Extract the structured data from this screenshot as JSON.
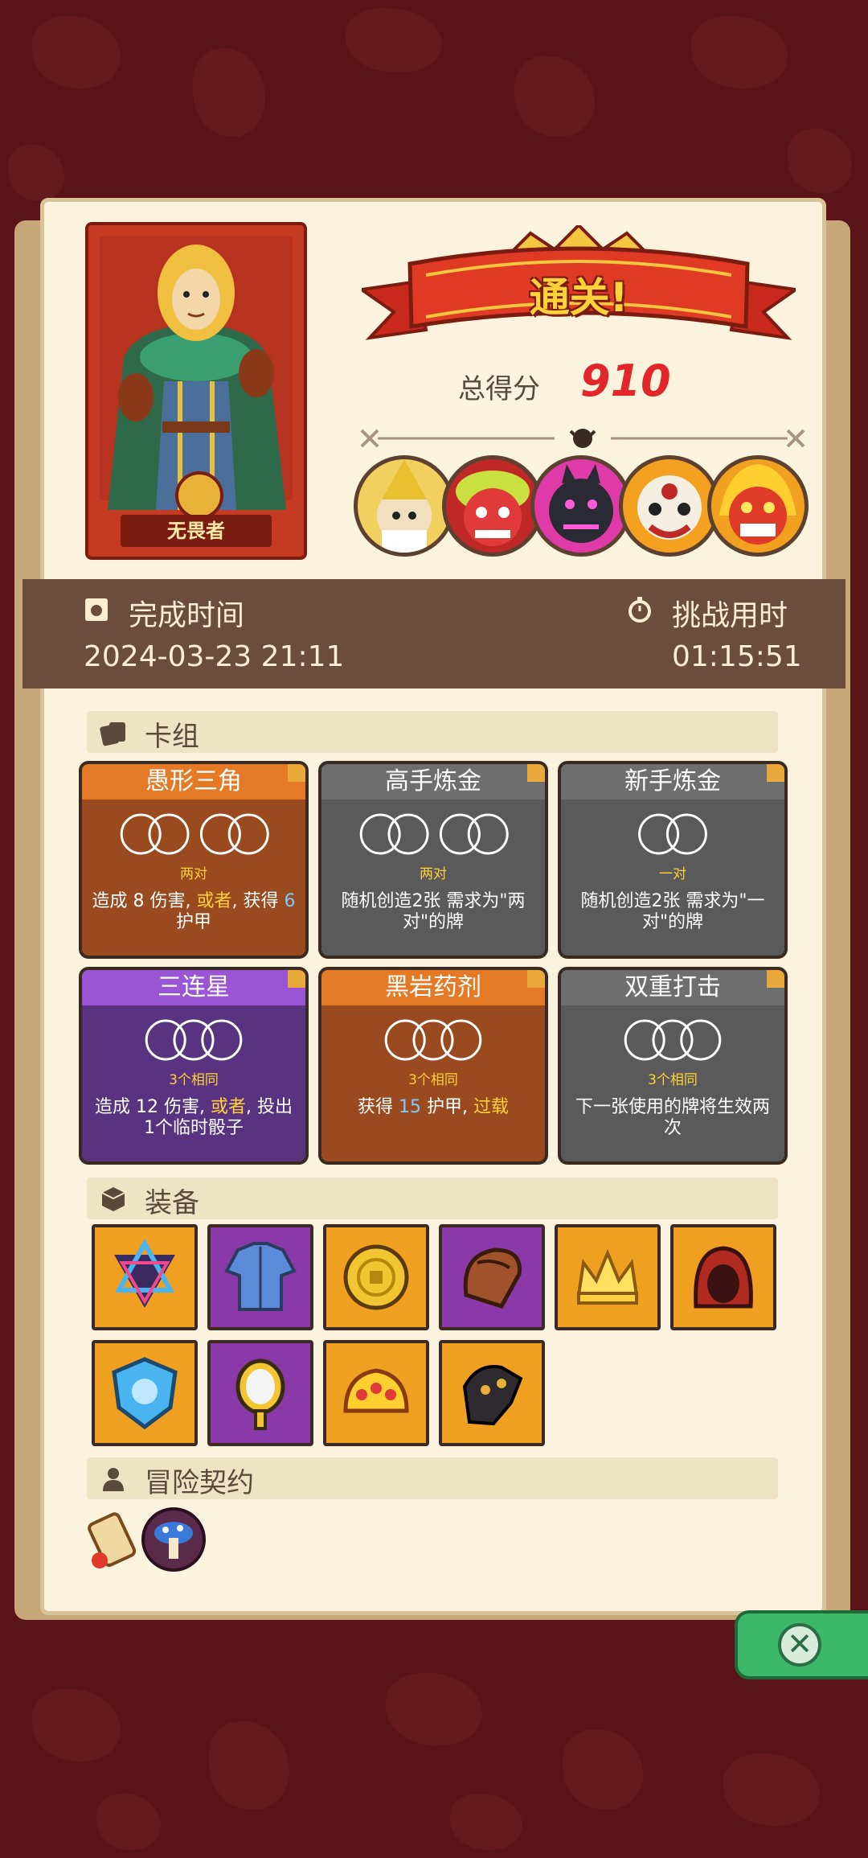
{
  "result": {
    "banner_title": "通关!",
    "score_label": "总得分",
    "score_value": "910"
  },
  "hero": {
    "name": "无畏者"
  },
  "info": {
    "finish_time_label": "完成时间",
    "finish_time_value": "2024-03-23 21:11",
    "challenge_time_label": "挑战用时",
    "challenge_time_value": "01:15:51"
  },
  "sections": {
    "deck": "卡组",
    "equipment": "装备",
    "contracts": "冒险契约"
  },
  "cards": [
    {
      "title": "愚形三角",
      "req": "两对",
      "desc_parts": [
        "造成 ",
        "8",
        " 伤害, ",
        "或者",
        ", 获得 ",
        "6",
        " 护甲"
      ],
      "color": "#9a4a1f",
      "header": "#e57a26"
    },
    {
      "title": "高手炼金",
      "req": "两对",
      "desc": "随机创造2张 需求为\"两对\"的牌",
      "color": "#5a5a5a",
      "header": "#6e6e6e"
    },
    {
      "title": "新手炼金",
      "req": "一对",
      "desc": "随机创造2张 需求为\"一对\"的牌",
      "color": "#5a5a5a",
      "header": "#6e6e6e"
    },
    {
      "title": "三连星",
      "req": "3个相同",
      "desc_parts": [
        "造成 ",
        "12",
        " 伤害, ",
        "或者",
        ", 投出1个临时骰子"
      ],
      "color": "#5a3380",
      "header": "#9a55d4"
    },
    {
      "title": "黑岩药剂",
      "req": "3个相同",
      "desc_parts": [
        "获得 ",
        "15",
        " 护甲, ",
        "过载"
      ],
      "color": "#9a4a1f",
      "header": "#e57a26"
    },
    {
      "title": "双重打击",
      "req": "3个相同",
      "desc": "下一张使用的牌将生效两次",
      "color": "#5a5a5a",
      "header": "#6e6e6e"
    }
  ],
  "colors": {
    "orange": "#f0a020",
    "purple": "#8a3aa8",
    "panel": "#fbf3de",
    "info_bar": "#6a4d3d"
  },
  "equipment_icons": [
    "triangle-emblem-icon",
    "tunic-icon",
    "gold-coin-icon",
    "leather-pauldron-icon",
    "crown-icon",
    "red-hood-icon",
    "blue-crest-shield-icon",
    "hand-mirror-icon",
    "jeweled-crown-icon",
    "dark-gauntlet-icon"
  ],
  "contract_icons": [
    "scroll-icon",
    "mushroom-emblem-icon"
  ]
}
